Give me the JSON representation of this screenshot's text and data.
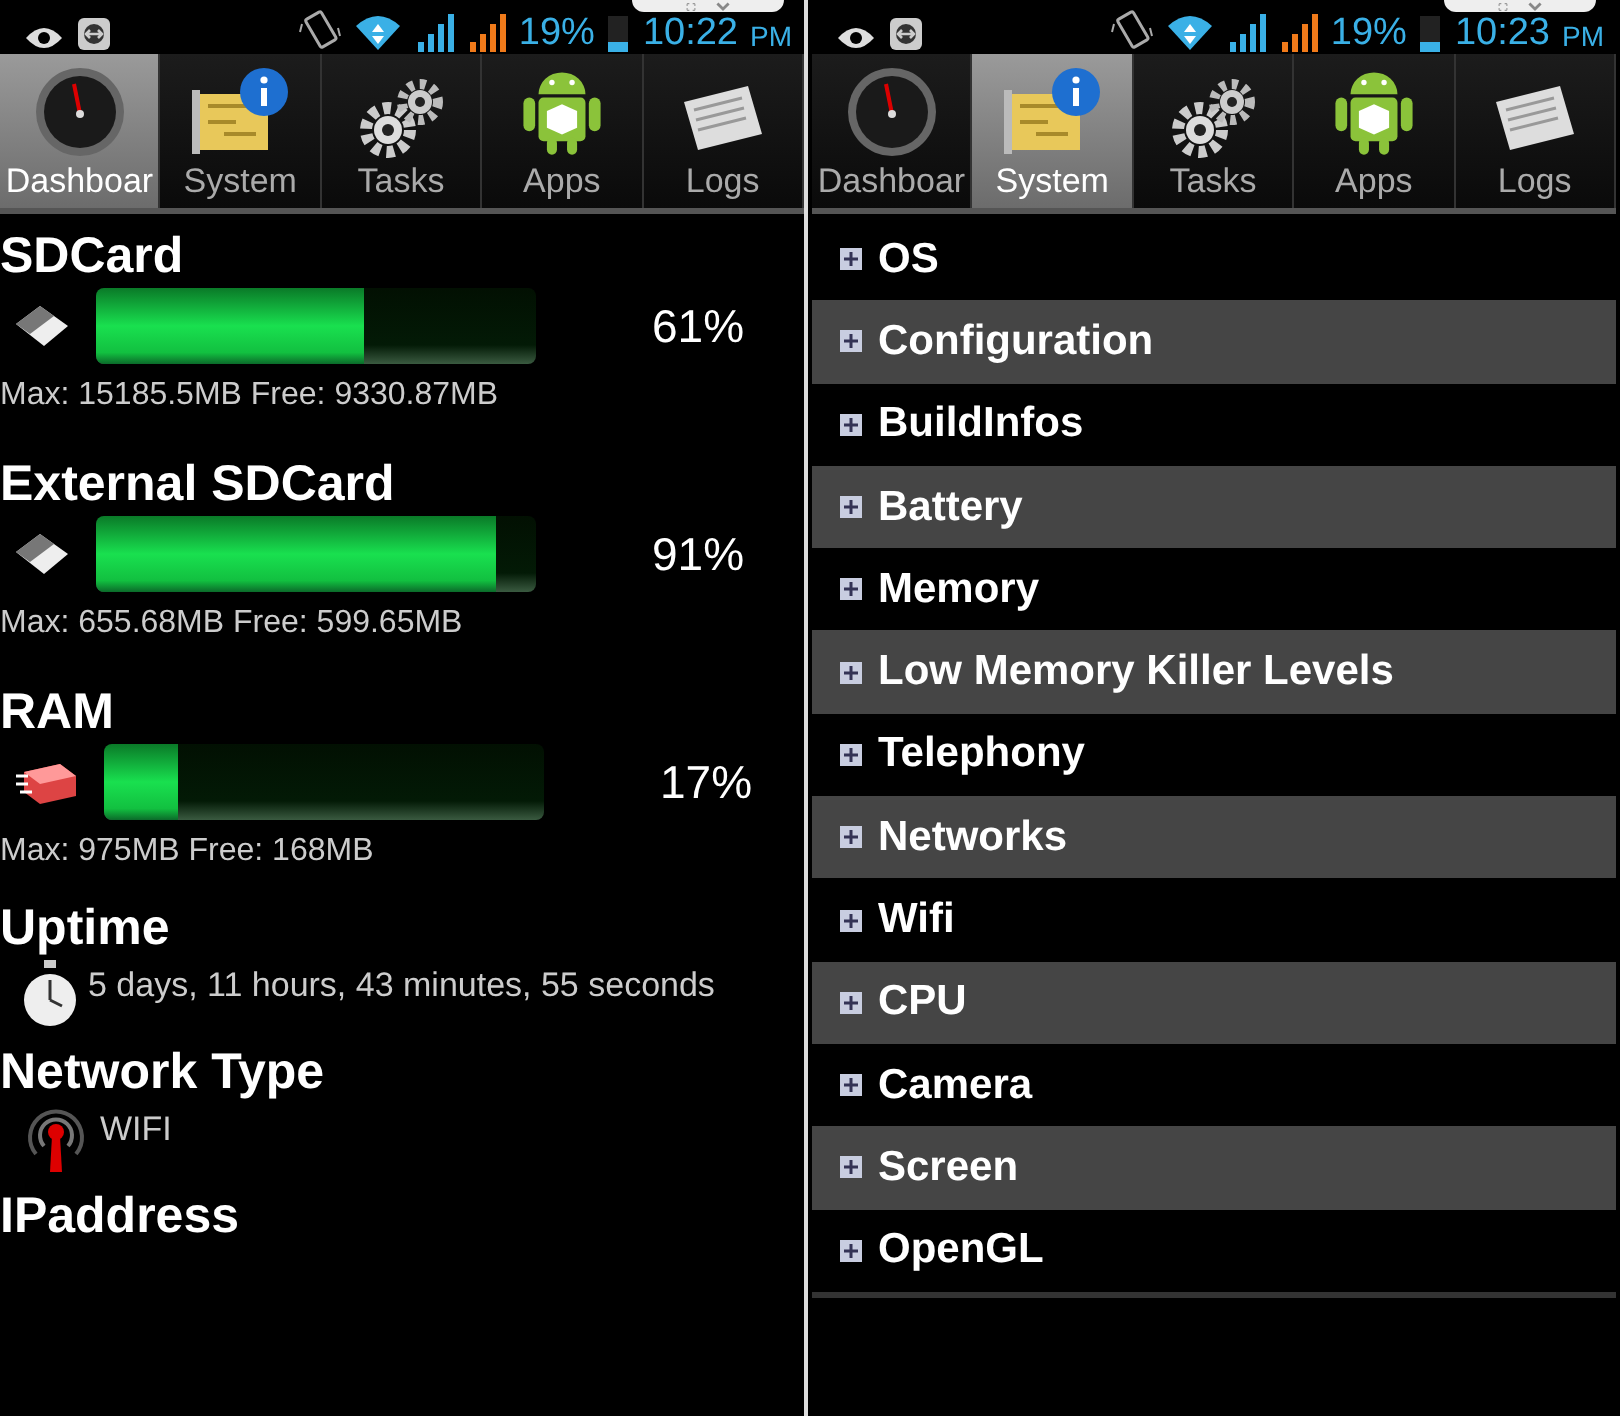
{
  "screens": [
    {
      "kind": "dashboard",
      "status_bar": {
        "battery": "19%",
        "time": "10:22",
        "ampm": "PM"
      },
      "tabs": [
        {
          "label": "Dashboar",
          "selected": true
        },
        {
          "label": "System",
          "selected": false
        },
        {
          "label": "Tasks",
          "selected": false
        },
        {
          "label": "Apps",
          "selected": false
        },
        {
          "label": "Logs",
          "selected": false
        }
      ],
      "storages": [
        {
          "kind": "sdcard",
          "title": "SDCard",
          "level": 0.61,
          "percent": "61%",
          "detail": "Max: 15185.5MB Free: 9330.87MB"
        },
        {
          "kind": "sdcard",
          "title": "External SDCard",
          "level": 0.91,
          "percent": "91%",
          "detail": "Max: 655.68MB Free: 599.65MB"
        },
        {
          "kind": "ram",
          "title": "RAM",
          "level": 0.17,
          "percent": "17%",
          "detail": "Max: 975MB Free: 168MB"
        }
      ],
      "infos": [
        {
          "kind": "uptime",
          "title": "Uptime",
          "value": "5 days, 11 hours, 43 minutes, 55 seconds"
        },
        {
          "kind": "network",
          "title": "Network Type",
          "value": "WIFI"
        },
        {
          "kind": "plain",
          "title": "IPaddress"
        }
      ]
    },
    {
      "kind": "system",
      "status_bar": {
        "battery": "19%",
        "time": "10:23",
        "ampm": "PM"
      },
      "tabs": [
        {
          "label": "Dashboar",
          "selected": false
        },
        {
          "label": "System",
          "selected": true
        },
        {
          "label": "Tasks",
          "selected": false
        },
        {
          "label": "Apps",
          "selected": false
        },
        {
          "label": "Logs",
          "selected": false
        }
      ],
      "items": [
        {
          "label": "OS",
          "expanded": false
        },
        {
          "label": "Configuration",
          "expanded": false
        },
        {
          "label": "BuildInfos",
          "expanded": false
        },
        {
          "label": "Battery",
          "expanded": false
        },
        {
          "label": "Memory",
          "expanded": false
        },
        {
          "label": "Low Memory Killer Levels",
          "expanded": false
        },
        {
          "label": "Telephony",
          "expanded": false
        },
        {
          "label": "Networks",
          "expanded": false
        },
        {
          "label": "Wifi",
          "expanded": false
        },
        {
          "label": "CPU",
          "expanded": false
        },
        {
          "label": "Camera",
          "expanded": false
        },
        {
          "label": "Screen",
          "expanded": false
        },
        {
          "label": "OpenGL",
          "expanded": false
        }
      ]
    }
  ]
}
